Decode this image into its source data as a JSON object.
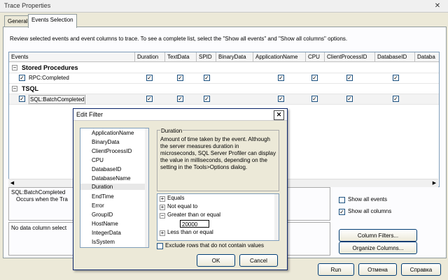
{
  "window": {
    "title": "Trace Properties",
    "close": "✕"
  },
  "tabs": [
    "General",
    "Events Selection"
  ],
  "description": "Review selected events and event columns to trace. To see a complete list, select the \"Show all events\" and \"Show all columns\" options.",
  "grid": {
    "columns": [
      "Events",
      "Duration",
      "TextData",
      "SPID",
      "BinaryData",
      "ApplicationName",
      "CPU",
      "ClientProcessID",
      "DatabaseID",
      "Databa"
    ],
    "categories": [
      {
        "expander": "−",
        "name": "Stored Procedures",
        "events": [
          {
            "name": "RPC:Completed",
            "checked": true
          }
        ]
      },
      {
        "expander": "−",
        "name": "TSQL",
        "events": [
          {
            "name": "SQL:BatchCompleted",
            "checked": true
          }
        ]
      }
    ],
    "check_mark": "✓"
  },
  "event_info": {
    "name": "SQL:BatchCompleted",
    "description": "Occurs when the Tra"
  },
  "column_info": {
    "text": "No data column select"
  },
  "options": {
    "show_all_events": "Show all events",
    "show_all_columns": "Show all columns",
    "show_all_events_checked": false,
    "show_all_columns_checked": true
  },
  "buttons": {
    "column_filters": "Column Filters...",
    "organize_columns": "Organize Columns...",
    "run": "Run",
    "cancel": "Отмена",
    "help": "Справка"
  },
  "dialog": {
    "title": "Edit Filter",
    "close": "✕",
    "columns": [
      "ApplicationName",
      "BinaryData",
      "ClientProcessID",
      "CPU",
      "DatabaseID",
      "DatabaseName",
      "Duration",
      "EndTime",
      "Error",
      "GroupID",
      "HostName",
      "IntegerData",
      "IsSystem"
    ],
    "selected_column": "Duration",
    "group_title": "Duration",
    "column_description": "Amount of time taken by the event. Although the server measures duration in microseconds, SQL Server Profiler can display the value in milliseconds, depending on the setting in the Tools>Options dialog.",
    "operators": [
      {
        "expander": "+",
        "label": "Equals"
      },
      {
        "expander": "+",
        "label": "Not equal to"
      },
      {
        "expander": "−",
        "label": "Greater than or equal"
      },
      {
        "expander": "+",
        "label": "Less than or equal"
      }
    ],
    "value": "20000",
    "exclude_label": "Exclude rows that do not contain values",
    "ok": "OK",
    "cancel": "Cancel"
  },
  "icons": {
    "close": "close-icon",
    "scroll_left": "◀",
    "scroll_right": "▶",
    "scroll_up": "▲",
    "scroll_down": "▼"
  }
}
